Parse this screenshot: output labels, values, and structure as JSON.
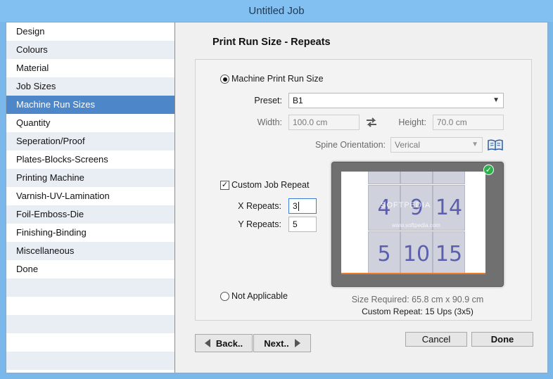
{
  "window": {
    "title": "Untitled Job"
  },
  "sidebar": {
    "items": [
      {
        "label": "Design"
      },
      {
        "label": "Colours"
      },
      {
        "label": "Material"
      },
      {
        "label": "Job Sizes"
      },
      {
        "label": "Machine Run Sizes"
      },
      {
        "label": "Quantity"
      },
      {
        "label": "Seperation/Proof"
      },
      {
        "label": "Plates-Blocks-Screens"
      },
      {
        "label": "Printing Machine"
      },
      {
        "label": "Varnish-UV-Lamination"
      },
      {
        "label": "Foil-Emboss-Die"
      },
      {
        "label": "Finishing-Binding"
      },
      {
        "label": "Miscellaneous"
      },
      {
        "label": "Done"
      }
    ],
    "selected": "Machine Run Sizes"
  },
  "page": {
    "title": "Print Run Size - Repeats"
  },
  "options": {
    "machine_run": "Machine Print Run Size",
    "custom_repeat": "Custom Job Repeat",
    "not_applicable": "Not Applicable"
  },
  "form": {
    "preset_label": "Preset:",
    "preset_value": "B1",
    "width_label": "Width:",
    "width_value": "100.0 cm",
    "height_label": "Height:",
    "height_value": "70.0 cm",
    "spine_label": "Spine Orientation:",
    "spine_value": "Verical",
    "x_repeats_label": "X Repeats:",
    "x_repeats_value": "3",
    "y_repeats_label": "Y Repeats:",
    "y_repeats_value": "5"
  },
  "preview": {
    "row1": [
      "4",
      "9",
      "14"
    ],
    "row2": [
      "5",
      "10",
      "15"
    ],
    "watermark": "SOFTPEDIA",
    "watermark_url": "www.softpedia.com",
    "size_required": "Size Required: 65.8 cm x 90.9 cm",
    "custom_repeat": "Custom Repeat: 15 Ups (3x5)",
    "accent": "#f07a2c",
    "ok_color": "#2bb24a"
  },
  "buttons": {
    "back": "Back..",
    "next": "Next..",
    "cancel": "Cancel",
    "done": "Done"
  },
  "icons": {
    "swap": "swap-icon",
    "book": "book-icon",
    "check": "check-icon"
  }
}
